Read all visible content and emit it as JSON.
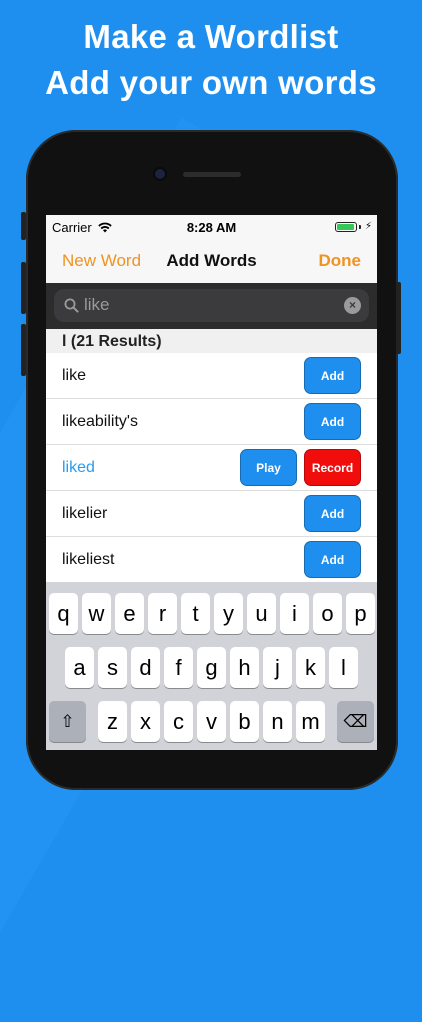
{
  "headline": {
    "line1": "Make a Wordlist",
    "line2": "Add your own words"
  },
  "status": {
    "carrier": "Carrier",
    "time": "8:28 AM"
  },
  "nav": {
    "left": "New Word",
    "title": "Add Words",
    "right": "Done"
  },
  "search": {
    "value": "like"
  },
  "section": {
    "header": "l (21 Results)"
  },
  "rows": [
    {
      "word": "like",
      "add": "Add"
    },
    {
      "word": "likeability's",
      "add": "Add"
    },
    {
      "word": "liked",
      "play": "Play",
      "record": "Record"
    },
    {
      "word": "likelier",
      "add": "Add"
    },
    {
      "word": "likeliest",
      "add": "Add"
    }
  ],
  "keyboard": {
    "row1": [
      "q",
      "w",
      "e",
      "r",
      "t",
      "y",
      "u",
      "i",
      "o",
      "p"
    ],
    "row2": [
      "a",
      "s",
      "d",
      "f",
      "g",
      "h",
      "j",
      "k",
      "l"
    ],
    "row3": [
      "z",
      "x",
      "c",
      "v",
      "b",
      "n",
      "m"
    ],
    "shift": "⇧",
    "delete": "⌫"
  },
  "colors": {
    "background": "#1e8fef",
    "accent_orange": "#f0931f",
    "button_blue": "#1e8fef",
    "record_red": "#f20d0d",
    "active_word": "#2a9bef"
  }
}
